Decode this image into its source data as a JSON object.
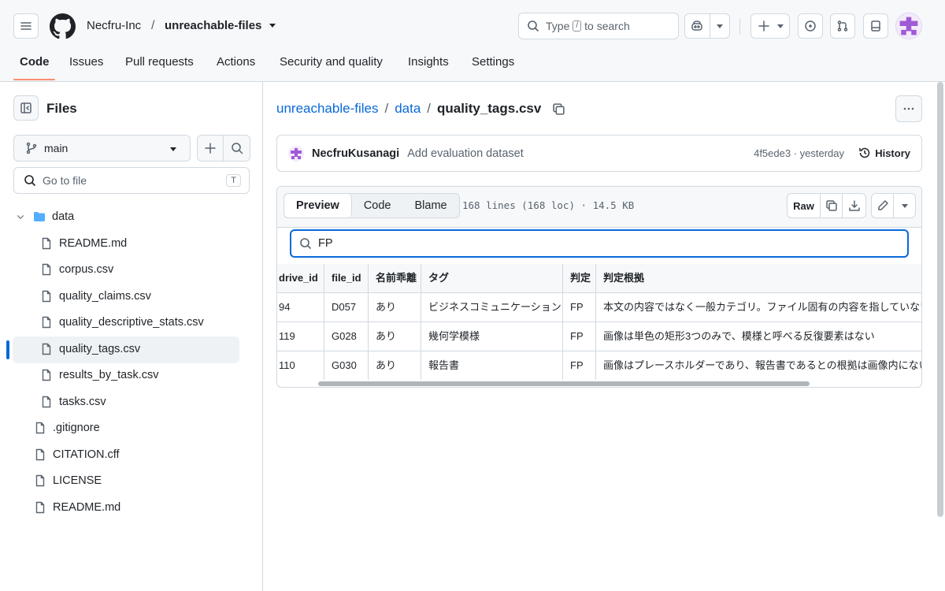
{
  "header": {
    "owner": "Necfru-Inc",
    "repo": "unreachable-files",
    "search_prefix": "Type",
    "search_key": "/",
    "search_suffix": "to search"
  },
  "tabs": [
    {
      "label": "Code"
    },
    {
      "label": "Issues"
    },
    {
      "label": "Pull requests"
    },
    {
      "label": "Actions"
    },
    {
      "label": "Security and quality"
    },
    {
      "label": "Insights"
    },
    {
      "label": "Settings"
    }
  ],
  "sidebar": {
    "title": "Files",
    "branch": "main",
    "goto_placeholder": "Go to file",
    "goto_key": "T",
    "tree": [
      {
        "label": "data",
        "type": "folder"
      },
      {
        "label": "README.md",
        "type": "file"
      },
      {
        "label": "corpus.csv",
        "type": "file"
      },
      {
        "label": "quality_claims.csv",
        "type": "file"
      },
      {
        "label": "quality_descriptive_stats.csv",
        "type": "file"
      },
      {
        "label": "quality_tags.csv",
        "type": "file"
      },
      {
        "label": "results_by_task.csv",
        "type": "file"
      },
      {
        "label": "tasks.csv",
        "type": "file"
      },
      {
        "label": ".gitignore",
        "type": "file"
      },
      {
        "label": "CITATION.cff",
        "type": "file"
      },
      {
        "label": "LICENSE",
        "type": "file"
      },
      {
        "label": "README.md",
        "type": "file"
      }
    ]
  },
  "breadcrumb": {
    "repo": "unreachable-files",
    "dir": "data",
    "file": "quality_tags.csv"
  },
  "commit": {
    "author": "NecfruKusanagi",
    "message": "Add evaluation dataset",
    "sha_time": "4f5ede3 · yesterday",
    "history": "History"
  },
  "file": {
    "tabs": [
      "Preview",
      "Code",
      "Blame"
    ],
    "meta": "168 lines (168 loc) · 14.5 KB",
    "raw": "Raw",
    "filter_value": "FP"
  },
  "table": {
    "headers": [
      "drive_id",
      "file_id",
      "名前乖離",
      "タグ",
      "判定",
      "判定根拠"
    ],
    "rows": [
      [
        "94",
        "D057",
        "あり",
        "ビジネスコミュニケーション",
        "FP",
        "本文の内容ではなく一般カテゴリ。ファイル固有の内容を指していない"
      ],
      [
        "119",
        "G028",
        "あり",
        "幾何学模様",
        "FP",
        "画像は単色の矩形3つのみで、模様と呼べる反復要素はない"
      ],
      [
        "110",
        "G030",
        "あり",
        "報告書",
        "FP",
        "画像はプレースホルダーであり、報告書であるとの根拠は画像内にない"
      ]
    ]
  }
}
